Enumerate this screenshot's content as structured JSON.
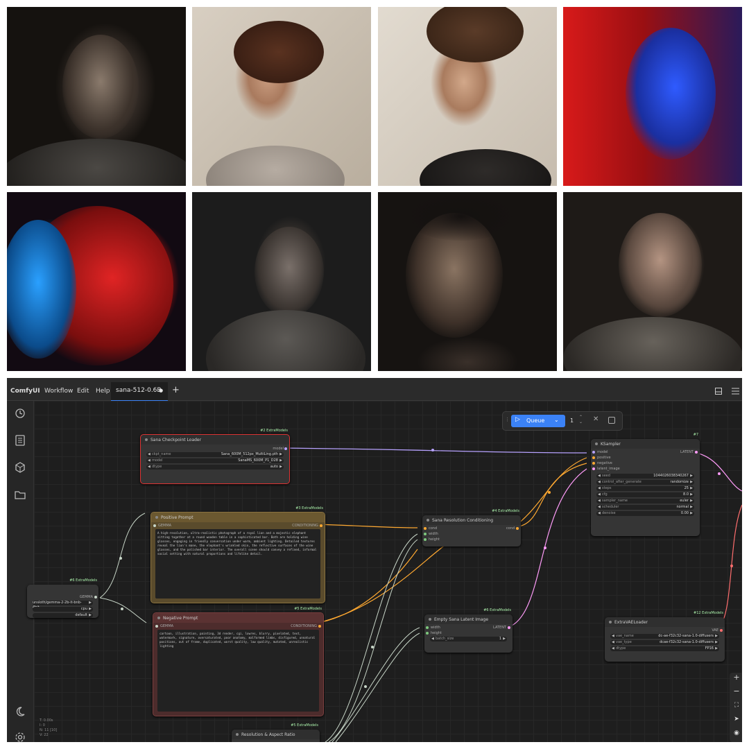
{
  "gallery": [
    {
      "id": "t1",
      "alt": "portrait-woman-dark"
    },
    {
      "id": "t2",
      "alt": "portrait-woman-glasses"
    },
    {
      "id": "t3",
      "alt": "portrait-man-glasses"
    },
    {
      "id": "t4",
      "alt": "portrait-woman-red-blue"
    },
    {
      "id": "t5",
      "alt": "portrait-man-red-blue"
    },
    {
      "id": "t6",
      "alt": "portrait-woman-sweater"
    },
    {
      "id": "t7",
      "alt": "portrait-man-dark"
    },
    {
      "id": "t8",
      "alt": "portrait-woman-smile"
    }
  ],
  "topbar": {
    "brand": "ComfyUI",
    "menu": [
      "Workflow",
      "Edit",
      "Help"
    ],
    "tab": "sana-512-0.6B",
    "tab_modified": "●",
    "new_tab": "+"
  },
  "queue": {
    "label": "Queue",
    "count": "1"
  },
  "nodes": {
    "checkpoint": {
      "title": "Sana Checkpoint Loader",
      "badge": "#2 ExtraModels",
      "out": "model",
      "widgets": [
        {
          "name": "ckpt_name",
          "value": "Sana_600M_512px_MultiLing.pth"
        },
        {
          "name": "model",
          "value": "SanaMS_600M_P1_D28"
        },
        {
          "name": "dtype",
          "value": "auto"
        }
      ]
    },
    "positive": {
      "title": "Positive Prompt",
      "badge": "#3 ExtraModels",
      "in": "GEMMA",
      "out": "CONDITIONING",
      "text": "A high-resolution, ultra-realistic photograph of a royal lion and a majestic elephant sitting together at a round wooden table in a sophisticated bar. Both are holding wine glasses, engaging in friendly conversation under warm, ambient lighting. Detailed textures reveal the lion's mane, the elephant's wrinkled skin, the reflective surfaces of the wine glasses, and the polished bar interior. The overall scene should convey a refined, informal social setting with natural proportions and lifelike detail."
    },
    "negative": {
      "title": "Negative Prompt",
      "badge": "#5 ExtraModels",
      "in": "GEMMA",
      "out": "CONDITIONING",
      "text": "cartoon, illustration, painting, 3d render, cgi, lowres, blurry, pixelated, text, watermark, signature, oversaturated, poor anatomy, malformed limbs, disfigured, unnatural positions, out of frame, duplicated, worst quality, low quality, mutated, unrealistic lighting"
    },
    "gemma": {
      "badge": "#6 ExtraModels",
      "out": "GEMMA",
      "widgets": [
        {
          "value": "unsloth/gemma-2-2b-it-bnb-4bit"
        },
        {
          "value": "cpu"
        },
        {
          "value": "default"
        }
      ]
    },
    "resolution": {
      "title": "Sana Resolution Conditioning",
      "badge": "#4 ExtraModels",
      "ins": [
        "cond",
        "width",
        "height"
      ],
      "out": "cond"
    },
    "latent": {
      "title": "Empty Sana Latent Image",
      "badge": "#6 ExtraModels",
      "ins": [
        "width",
        "height"
      ],
      "out": "LATENT",
      "widgets": [
        {
          "name": "batch_size",
          "value": "1"
        }
      ]
    },
    "ksampler": {
      "title": "KSampler",
      "badge": "#7",
      "ins": [
        "model",
        "positive",
        "negative",
        "latent_image"
      ],
      "out": "LATENT",
      "widgets": [
        {
          "name": "seed",
          "value": "1044026038340267"
        },
        {
          "name": "control_after_generate",
          "value": "randomize"
        },
        {
          "name": "steps",
          "value": "25"
        },
        {
          "name": "cfg",
          "value": "8.0"
        },
        {
          "name": "sampler_name",
          "value": "euler"
        },
        {
          "name": "scheduler",
          "value": "normal"
        },
        {
          "name": "denoise",
          "value": "0.00"
        }
      ]
    },
    "vae": {
      "title": "ExtraVAELoader",
      "badge": "#12 ExtraModels",
      "out": "VAE",
      "widgets": [
        {
          "name": "vae_name",
          "value": "dc-ae-f32c32-sana-1.0-diffusers"
        },
        {
          "name": "vae_type",
          "value": "dcae-f32c32-sana-1.0-diffusers"
        },
        {
          "name": "dtype",
          "value": "FP16"
        }
      ]
    },
    "aspect": {
      "title": "Resolution & Aspect Ratio",
      "badge": "#5 ExtraModels"
    }
  },
  "stats": [
    "T: 0.00s",
    "I: 0",
    "N: 11 [10]",
    "V: 22"
  ],
  "colors": {
    "accent": "#3b82f6",
    "model": "#b7a2ff",
    "cond": "#ffa931",
    "latent": "#ff9cf9",
    "vae": "#ff6e6e",
    "gemma": "#c8d6c8"
  }
}
